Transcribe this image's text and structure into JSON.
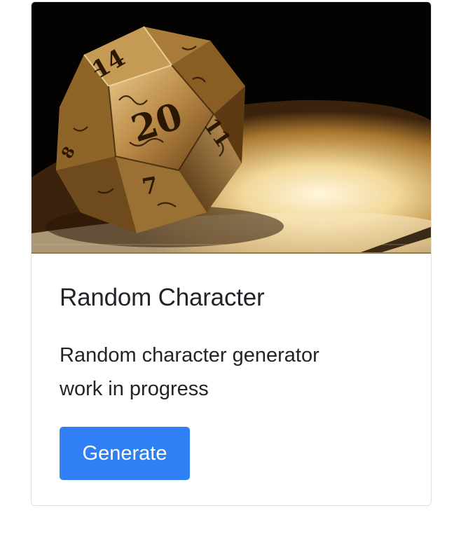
{
  "card": {
    "image": {
      "description_icon": "d20-dice-photo"
    },
    "title": "Random Character",
    "text": "Random character generator work in progress",
    "button_label": "Generate"
  },
  "colors": {
    "button_bg": "#2f80f5",
    "button_text": "#ffffff",
    "title_text": "#212529",
    "card_border": "#dfdfdf"
  }
}
